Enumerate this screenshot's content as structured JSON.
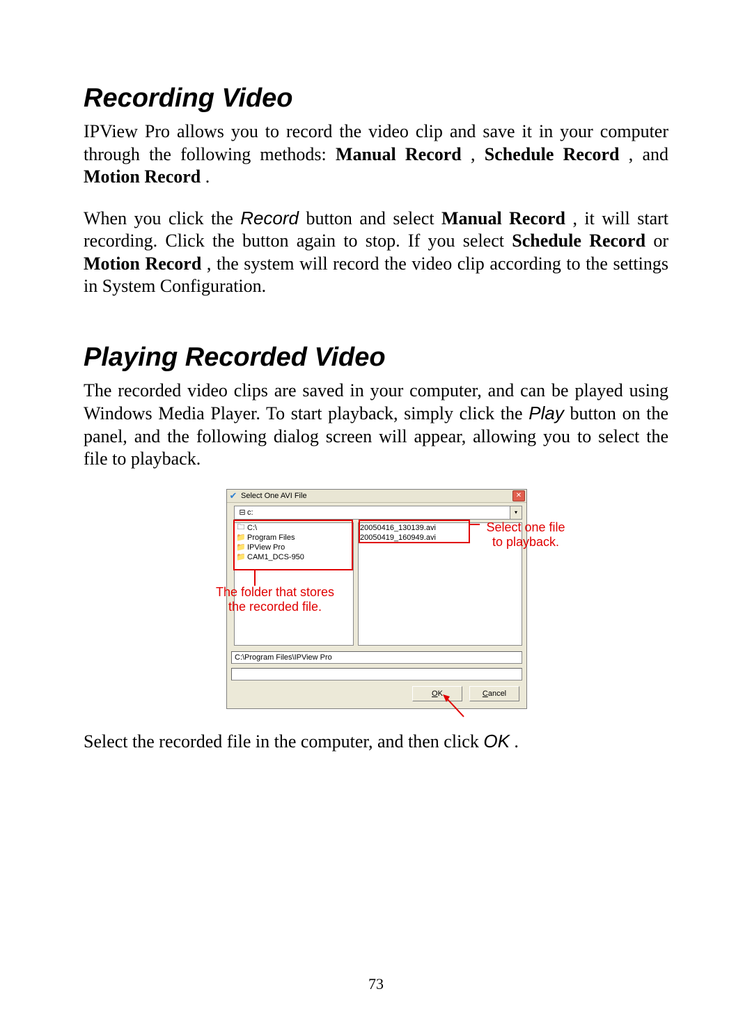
{
  "headings": {
    "recording": "Recording Video",
    "playing": "Playing Recorded Video"
  },
  "paragraphs": {
    "rec_p1_a": "IPView Pro allows you to record the video clip and save it in your computer through the following methods: ",
    "rec_p1_b1": "Manual Record",
    "rec_p1_sep1": ", ",
    "rec_p1_b2": "Schedule Record",
    "rec_p1_sep2": ", and ",
    "rec_p1_b3": "Motion Record",
    "rec_p1_end": ".",
    "rec_p2_a": "When you click the ",
    "rec_p2_i1": "Record",
    "rec_p2_b": " button and select ",
    "rec_p2_b1": "Manual Record",
    "rec_p2_c": ", it will start recording.  Click the button again to stop.  If you select ",
    "rec_p2_b2": "Schedule Record",
    "rec_p2_or": " or ",
    "rec_p2_b3": "Motion Record",
    "rec_p2_d": ", the system will record the video clip according to the settings in System Configuration.",
    "play_p1_a": "The recorded video clips are saved in your computer, and can be played using Windows Media Player.  To start playback, simply click the ",
    "play_p1_i1": "Play",
    "play_p1_b": " button on the panel, and the following dialog screen will appear, allowing you to select the file to playback.",
    "after_a": "Select the recorded file in the computer, and then click ",
    "after_i": "OK",
    "after_b": "."
  },
  "dialog": {
    "title": "Select One AVI File",
    "drive_label": "c:",
    "folder_items": [
      {
        "label": "C:\\",
        "icon": "🗀",
        "indent": 0
      },
      {
        "label": "Program Files",
        "icon": "📁",
        "indent": 1
      },
      {
        "label": "IPView Pro",
        "icon": "📁",
        "indent": 2
      },
      {
        "label": "CAM1_DCS-950",
        "icon": "📁",
        "indent": 3
      }
    ],
    "file_items": [
      "20050416_130139.avi",
      "20050419_160949.avi"
    ],
    "path_value": "C:\\Program Files\\IPView Pro",
    "ok_u": "O",
    "ok_rest": "K",
    "cancel_u": "C",
    "cancel_rest": "ancel"
  },
  "callouts": {
    "folder_hint_l1": "The folder that stores",
    "folder_hint_l2": "the recorded file.",
    "file_hint_l1": "Select one file",
    "file_hint_l2": "to playback."
  },
  "page_number": "73"
}
